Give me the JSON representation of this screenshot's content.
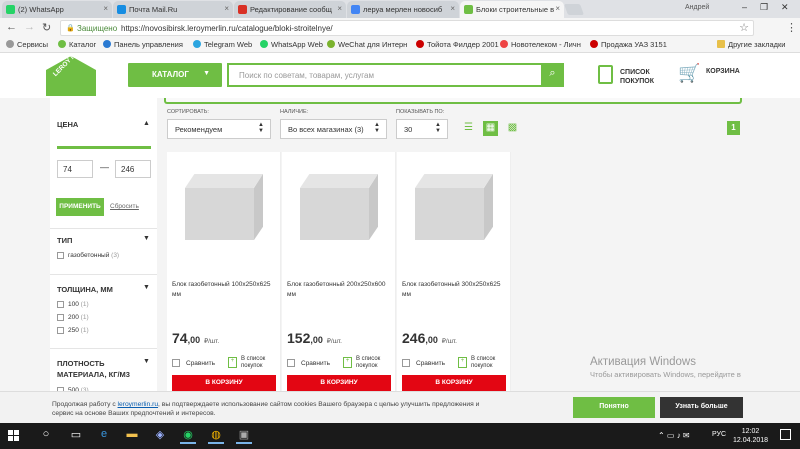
{
  "browser": {
    "tabs": [
      {
        "label": "(2) WhatsApp",
        "color": "#25d366"
      },
      {
        "label": "Почта Mail.Ru",
        "color": "#168de2"
      },
      {
        "label": "Редактирование сообщ",
        "color": "#d93025"
      },
      {
        "label": "леруа мерлен новосиб",
        "color": "#4285f4"
      },
      {
        "label": "Блоки строительные в",
        "color": "#6fbe44"
      }
    ],
    "user": "Андрей",
    "secure_label": "Защищено",
    "url": "https://novosibirsk.leroymerlin.ru/catalogue/bloki-stroitelnye/",
    "bookmarks": [
      {
        "label": "Сервисы",
        "color": "#999"
      },
      {
        "label": "Каталог",
        "color": "#6fbe44"
      },
      {
        "label": "Панель управления",
        "color": "#2a7ad2"
      },
      {
        "label": "Telegram Web",
        "color": "#2ca5e0"
      },
      {
        "label": "WhatsApp Web",
        "color": "#25d366"
      },
      {
        "label": "WeChat для Интерн",
        "color": "#7bb32e"
      },
      {
        "label": "Тойота Филдер 2001",
        "color": "#c00"
      },
      {
        "label": "Новотелеком - Личн",
        "color": "#e44"
      },
      {
        "label": "Продажа УАЗ 3151",
        "color": "#c00"
      }
    ],
    "other_bookmarks": "Другие закладки"
  },
  "header": {
    "logo_text": "LEROY MERLIN",
    "catalog_button": "КАТАЛОГ",
    "search_placeholder": "Поиск по советам, товарам, услугам",
    "shopping_list": "СПИСОК ПОКУПОК",
    "cart": "КОРЗИНА"
  },
  "filters": {
    "price": {
      "title": "ЦЕНА",
      "min": "74",
      "max": "246",
      "apply": "ПРИМЕНИТЬ",
      "reset": "Сбросить"
    },
    "type": {
      "title": "ТИП",
      "options": [
        {
          "label": "газобетонный",
          "count": "(3)"
        }
      ]
    },
    "thickness": {
      "title": "ТОЛЩИНА, ММ",
      "options": [
        {
          "label": "100",
          "count": "(1)"
        },
        {
          "label": "200",
          "count": "(1)"
        },
        {
          "label": "250",
          "count": "(1)"
        }
      ]
    },
    "density": {
      "title": "ПЛОТНОСТЬ МАТЕРИАЛА, КГ/М3",
      "options": [
        {
          "label": "500",
          "count": "(3)"
        }
      ]
    }
  },
  "toolbar": {
    "sort_label": "СОРТИРОВАТЬ:",
    "sort_value": "Рекомендуем",
    "availability_label": "НАЛИЧИЕ:",
    "availability_value": "Во всех магазинах (3)",
    "per_page_label": "ПОКАЗЫВАТЬ ПО:",
    "per_page_value": "30",
    "page": "1"
  },
  "products": [
    {
      "name": "Блок газобетонный 100x250x625 мм",
      "price_int": "74",
      "price_dec": ",00",
      "unit": "₽/шт."
    },
    {
      "name": "Блок газобетонный 200x250x600 мм",
      "price_int": "152",
      "price_dec": ",00",
      "unit": "₽/шт."
    },
    {
      "name": "Блок газобетонный 300x250x625 мм",
      "price_int": "246",
      "price_dec": ",00",
      "unit": "₽/шт."
    }
  ],
  "product_actions": {
    "compare": "Сравнить",
    "to_list": "В список покупок",
    "buy": "В КОРЗИНУ"
  },
  "activation": {
    "title": "Активация Windows",
    "subtitle": "Чтобы активировать Windows, перейдите в"
  },
  "cookie": {
    "text_before": "Продолжая работу с ",
    "link": "leroymerlin.ru",
    "text_after": ", вы подтверждаете использование сайтом cookies Вашего браузера с целью улучшить предложения и сервис на основе Ваших предпочтений и интересов.",
    "ok": "Понятно",
    "more": "Узнать больше"
  },
  "taskbar": {
    "lang": "РУС",
    "time": "12:02",
    "date": "12.04.2018"
  }
}
